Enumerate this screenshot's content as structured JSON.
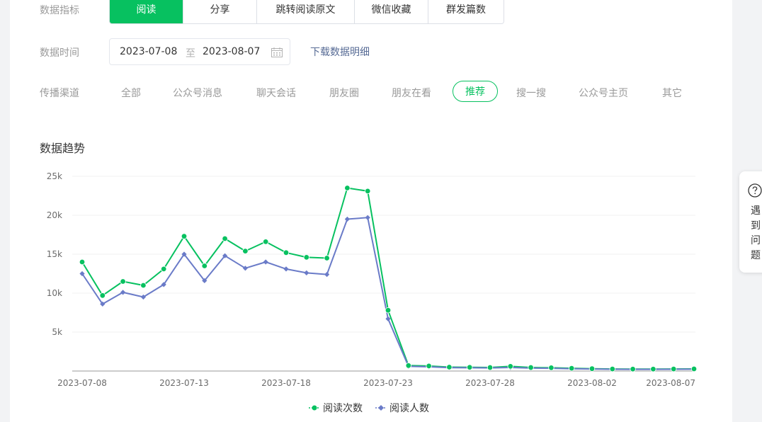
{
  "filters": {
    "metric_label": "数据指标",
    "metric_tabs": [
      "阅读",
      "分享",
      "跳转阅读原文",
      "微信收藏",
      "群发篇数"
    ],
    "metric_active": "阅读",
    "time_label": "数据时间",
    "date_start": "2023-07-08",
    "date_sep": "至",
    "date_end": "2023-08-07",
    "download_label": "下载数据明细",
    "channel_label": "传播渠道",
    "channels": [
      "全部",
      "公众号消息",
      "聊天会话",
      "朋友圈",
      "朋友在看",
      "推荐",
      "搜一搜",
      "公众号主页",
      "其它"
    ],
    "channel_active": "推荐"
  },
  "section_title": "数据趋势",
  "help": {
    "text": "遇到问题"
  },
  "colors": {
    "accent": "#07c160",
    "series2": "#6a7bc8",
    "link": "#576b95"
  },
  "chart_data": {
    "type": "line",
    "x": [
      "2023-07-08",
      "2023-07-09",
      "2023-07-10",
      "2023-07-11",
      "2023-07-12",
      "2023-07-13",
      "2023-07-14",
      "2023-07-15",
      "2023-07-16",
      "2023-07-17",
      "2023-07-18",
      "2023-07-19",
      "2023-07-20",
      "2023-07-21",
      "2023-07-22",
      "2023-07-23",
      "2023-07-24",
      "2023-07-25",
      "2023-07-26",
      "2023-07-27",
      "2023-07-28",
      "2023-07-29",
      "2023-07-30",
      "2023-07-31",
      "2023-08-01",
      "2023-08-02",
      "2023-08-03",
      "2023-08-04",
      "2023-08-05",
      "2023-08-06",
      "2023-08-07"
    ],
    "xtick_labels": [
      "2023-07-08",
      "2023-07-13",
      "2023-07-18",
      "2023-07-23",
      "2023-07-28",
      "2023-08-02",
      "2023-08-07"
    ],
    "ytick_labels": [
      "5k",
      "10k",
      "15k",
      "20k",
      "25k"
    ],
    "ylim": [
      0,
      25000
    ],
    "grid": true,
    "legend_position": "bottom",
    "series": [
      {
        "name": "阅读次数",
        "color": "#07c160",
        "marker": "circle",
        "values": [
          14000,
          9700,
          11500,
          11000,
          13100,
          17300,
          13500,
          17000,
          15400,
          16600,
          15200,
          14600,
          14500,
          23500,
          23100,
          7800,
          700,
          650,
          500,
          480,
          450,
          600,
          450,
          420,
          350,
          300,
          260,
          250,
          250,
          260,
          270
        ]
      },
      {
        "name": "阅读人数",
        "color": "#6a7bc8",
        "marker": "diamond",
        "values": [
          12500,
          8600,
          10100,
          9500,
          11100,
          15000,
          11600,
          14800,
          13200,
          14000,
          13100,
          12600,
          12400,
          19500,
          19700,
          6700,
          600,
          550,
          430,
          420,
          400,
          450,
          380,
          350,
          300,
          260,
          230,
          220,
          220,
          230,
          240
        ]
      }
    ]
  }
}
